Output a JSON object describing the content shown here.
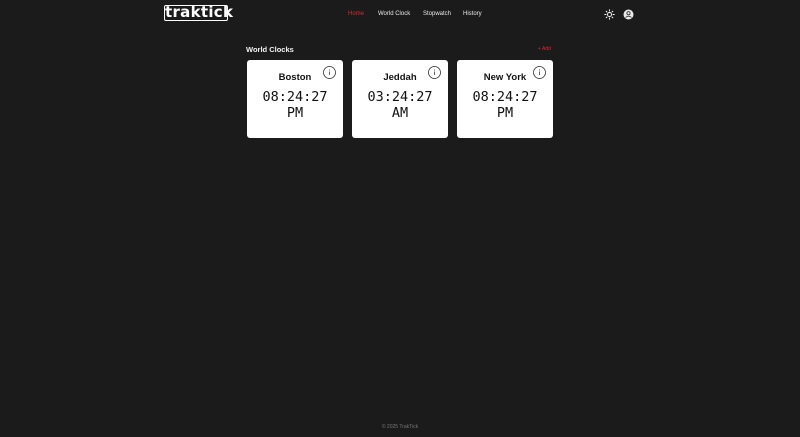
{
  "header": {
    "logo": "traktick",
    "nav": [
      {
        "label": "Home",
        "active": true
      },
      {
        "label": "World Clock",
        "active": false
      },
      {
        "label": "Stopwatch",
        "active": false
      },
      {
        "label": "History",
        "active": false
      }
    ],
    "theme_icon": "sun-icon",
    "user_icon": "user-icon"
  },
  "section": {
    "title": "World Clocks",
    "add_label": "+ Add"
  },
  "clocks": [
    {
      "city": "Boston",
      "time": "08:24:27",
      "period": "PM"
    },
    {
      "city": "Jeddah",
      "time": "03:24:27",
      "period": "AM"
    },
    {
      "city": "New York",
      "time": "08:24:27",
      "period": "PM"
    }
  ],
  "footer": {
    "text": "© 2025 TrakTick"
  },
  "colors": {
    "background": "#1c1b1c",
    "accent": "#e0252f",
    "card": "#ffffff"
  }
}
